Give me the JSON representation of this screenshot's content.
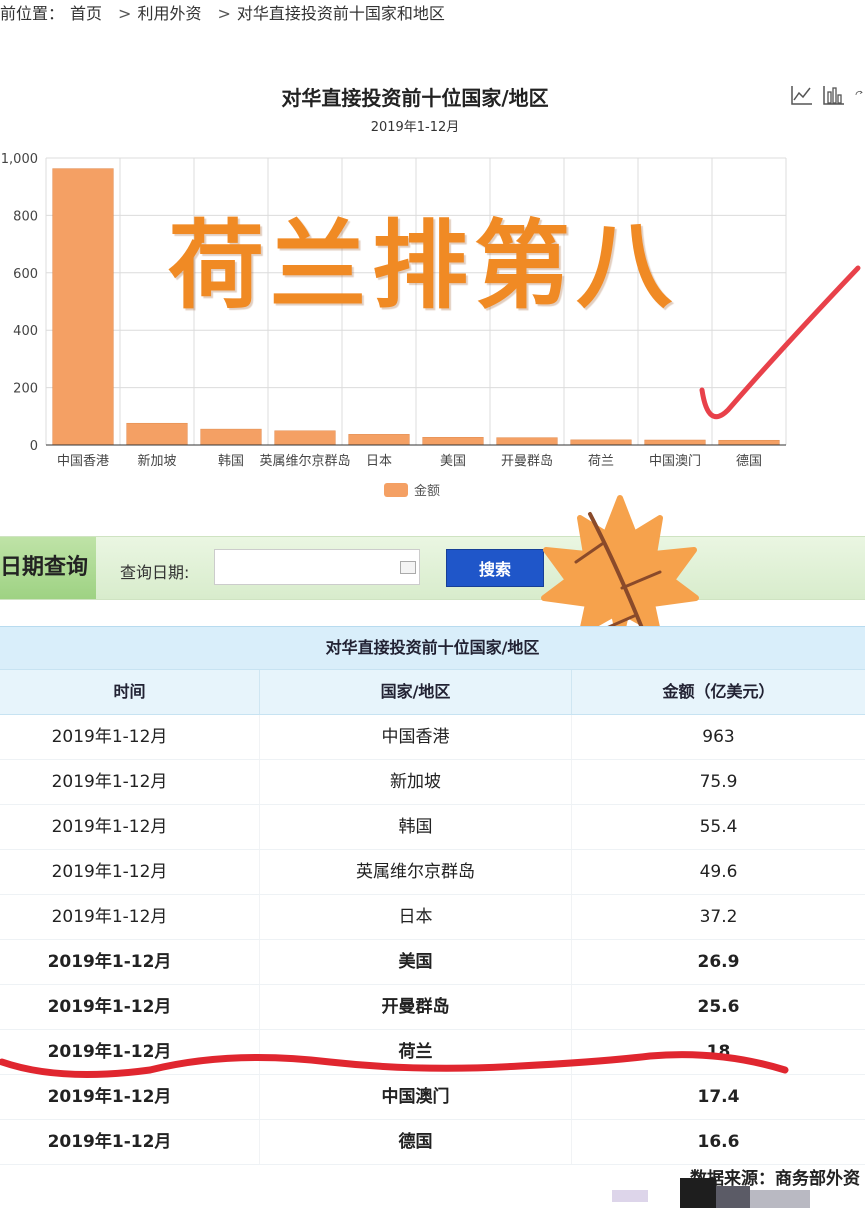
{
  "breadcrumb": {
    "prefix": "前位置：",
    "items": [
      "首页",
      "利用外资",
      "对华直接投资前十国家和地区"
    ],
    "separator": ">"
  },
  "chart_data": {
    "type": "bar",
    "title": "对华直接投资前十位国家/地区",
    "subtitle": "2019年1-12月",
    "categories": [
      "中国香港",
      "新加坡",
      "韩国",
      "英属维尔京群岛",
      "日本",
      "美国",
      "开曼群岛",
      "荷兰",
      "中国澳门",
      "德国"
    ],
    "series": [
      {
        "name": "金额",
        "values": [
          963,
          75.9,
          55.4,
          49.6,
          37.2,
          26.9,
          25.6,
          18,
          17.4,
          16.6
        ]
      }
    ],
    "yticks": [
      "0",
      "200",
      "400",
      "600",
      "800",
      "1,000"
    ],
    "ylim": [
      0,
      1000
    ],
    "grid": true,
    "legend": "bottom",
    "bar_color": "#f4a064"
  },
  "overlay": {
    "text": "荷兰排第八",
    "color": "#f08a24",
    "check_color": "#e8414a"
  },
  "query": {
    "tab_label": "日期查询",
    "date_label": "查询日期:",
    "date_value": "",
    "search_label": "搜索"
  },
  "table": {
    "caption": "对华直接投资前十位国家/地区",
    "headers": [
      "时间",
      "国家/地区",
      "金额（亿美元）"
    ],
    "rows": [
      [
        "2019年1-12月",
        "中国香港",
        "963"
      ],
      [
        "2019年1-12月",
        "新加坡",
        "75.9"
      ],
      [
        "2019年1-12月",
        "韩国",
        "55.4"
      ],
      [
        "2019年1-12月",
        "英属维尔京群岛",
        "49.6"
      ],
      [
        "2019年1-12月",
        "日本",
        "37.2"
      ],
      [
        "2019年1-12月",
        "美国",
        "26.9"
      ],
      [
        "2019年1-12月",
        "开曼群岛",
        "25.6"
      ],
      [
        "2019年1-12月",
        "荷兰",
        "18"
      ],
      [
        "2019年1-12月",
        "中国澳门",
        "17.4"
      ],
      [
        "2019年1-12月",
        "德国",
        "16.6"
      ]
    ],
    "bold_from_row": 5,
    "underline_color": "#e0262f"
  },
  "footer": {
    "source": "数据来源：商务部外资"
  },
  "icons": [
    "line-chart-icon",
    "bar-chart-icon",
    "refresh-icon",
    "calendar-icon",
    "maple-leaf-icon"
  ]
}
